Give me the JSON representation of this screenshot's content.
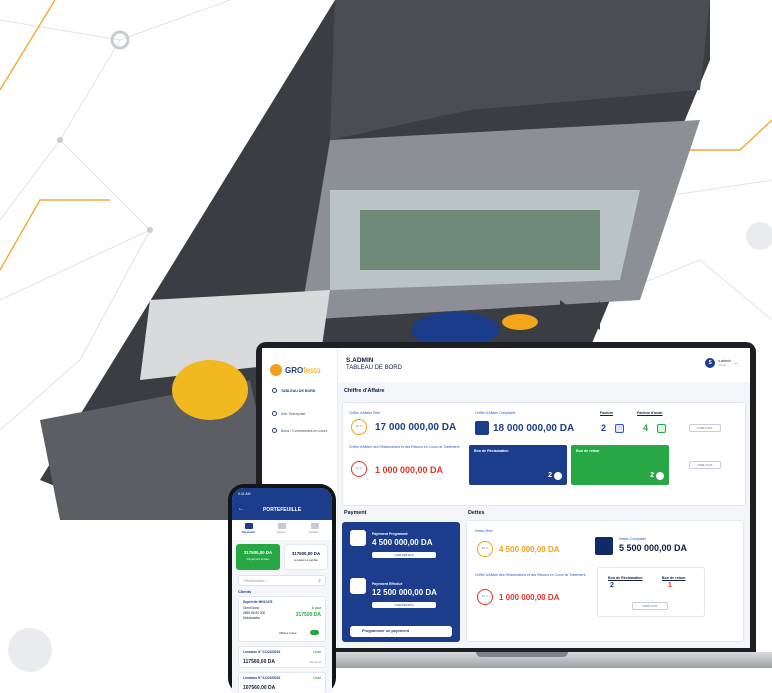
{
  "dashboard": {
    "logo_brand": "GRO",
    "logo_suffix": "festo",
    "sidebar": {
      "items": [
        {
          "label": "TABLEAU DE BORD"
        },
        {
          "label": "Info. Entreprise"
        },
        {
          "label": "Bons / Commandes en cours"
        }
      ]
    },
    "header": {
      "title": "S.ADMIN",
      "subtitle": "TABLEAU DE BORD",
      "user_initial": "S",
      "user_name": "s.admin",
      "user_role": "Admin"
    },
    "chiffre": {
      "section_title": "Chiffre d'Affaire",
      "reel_label": "Chiffre d'Affaire Réel",
      "reel_pct": "90 %",
      "reel_value": "17 000 000,00 DA",
      "comptable_label": "Chiffre d'Affaire Comptable",
      "comptable_value": "18 000 000,00 DA",
      "reclam_label": "Chiffre d'Affaire des Réclamations et des Retours en Cours de Traitement",
      "reclam_pct": "10 %",
      "reclam_value": "1 000 000,00 DA",
      "facture_label": "Facture",
      "facture_count": "2",
      "avoir_label": "Facture d'avoir",
      "avoir_count": "4",
      "voir_tout": "VOIR TOUT",
      "bon_reclam_label": "Bon de Réclamation",
      "bon_reclam_count": "2",
      "bon_retour_label": "Bon de retour",
      "bon_retour_count": "2"
    },
    "payment": {
      "section_title": "Payment",
      "prog_label": "Payement Programmé",
      "prog_value": "4 500 000,00 DA",
      "prog_btn": "VOIR DÉTAILS",
      "eff_label": "Payement Effectué",
      "eff_value": "12 500 000,00 DA",
      "eff_btn": "VOIR DÉTAILS",
      "main_btn": "Programmer un payement"
    },
    "dettes": {
      "section_title": "Dettes",
      "reel_label": "Dettes Réel",
      "reel_pct": "55 %",
      "reel_value": "4 500 000,00 DA",
      "comptable_label": "Dettes Comptable",
      "comptable_value": "5 500 000,00 DA",
      "reclam_label": "Chiffre d'Affaire des Réclamations et des Retours en Cours de Traitement",
      "reclam_pct": "15 %",
      "reclam_value": "1 000 000,00 DA",
      "bon_reclam_label": "Bon de Réclamation",
      "bon_reclam_count": "2",
      "bon_retour_label": "Bon de retour",
      "bon_retour_count": "1",
      "voir_tout": "VOIR TOUT"
    }
  },
  "phone": {
    "time": "9:41 AM",
    "title": "PORTEFEUILLE",
    "tabs": [
      {
        "label": "Payement"
      },
      {
        "label": "Retour"
      },
      {
        "label": "Réclam."
      }
    ],
    "bal_green_value": "317500,00 DA",
    "bal_green_label": "Payement à faire",
    "bal_white_value": "317500,00 DA",
    "bal_white_label": "Livraison à verifier",
    "search_placeholder": "Rechercher...",
    "clients_label": "Clients",
    "client": {
      "name": "Supérette MH12476",
      "person": "Gient Nono",
      "phone": "0555 66 60 000",
      "city": "Mohamadia",
      "status": "À jour",
      "amount": "317500 DA",
      "filter_label": "Afficher retour"
    },
    "livraisons": [
      {
        "title": "Livraison N° 0122425016",
        "status": "Livré",
        "amount": "117560,00 DA",
        "extra": "Voir bons"
      },
      {
        "title": "Livraison N° 0122425016",
        "status": "Livré",
        "amount": "107560,00 DA",
        "extra": ""
      }
    ]
  },
  "colors": {
    "brand_blue": "#1b3d8c",
    "accent_orange": "#f29f1c",
    "success_green": "#27a844",
    "danger_red": "#e0352b"
  }
}
